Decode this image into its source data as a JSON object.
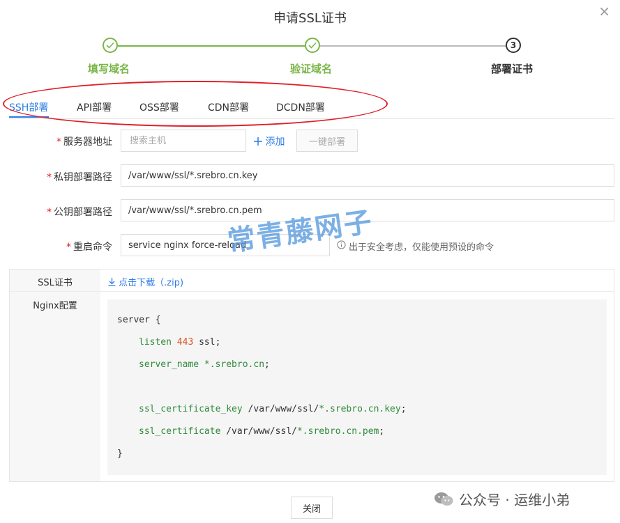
{
  "dialog": {
    "title": "申请SSL证书",
    "close_glyph": "×"
  },
  "steps": [
    {
      "label": "填写域名",
      "state": "done"
    },
    {
      "label": "验证域名",
      "state": "done"
    },
    {
      "label": "部署证书",
      "state": "current",
      "number": "3"
    }
  ],
  "colors": {
    "accent": "#2d7be5",
    "success": "#7ab648",
    "required": "#e0202a",
    "annotation": "#e0202a"
  },
  "tabs": [
    {
      "label": "SSH部署",
      "active": true
    },
    {
      "label": "API部署"
    },
    {
      "label": "OSS部署"
    },
    {
      "label": "CDN部署"
    },
    {
      "label": "DCDN部署"
    }
  ],
  "form": {
    "required_mark": "*",
    "server": {
      "label": "服务器地址",
      "placeholder": "搜索主机",
      "add_label": "添加",
      "deploy_label": "一键部署"
    },
    "key_path": {
      "label": "私钥部署路径",
      "value": "/var/www/ssl/*.srebro.cn.key"
    },
    "cert_path": {
      "label": "公钥部署路径",
      "value": "/var/www/ssl/*.srebro.cn.pem"
    },
    "restart": {
      "label": "重启命令",
      "value": "service nginx force-reload",
      "hint": "出于安全考虑，仅能使用预设的命令"
    }
  },
  "info": {
    "ssl_label": "SSL证书",
    "download_label": "点击下载（.zip)",
    "nginx_label": "Nginx配置"
  },
  "code": {
    "l1_a": "server",
    "l1_b": " {",
    "l2_kw": "listen",
    "l2_num": "443",
    "l2_rest": " ssl;",
    "l3_kw": "server_name",
    "l3_val": "*.srebro.cn",
    "l3_end": ";",
    "l4_kw": "ssl_certificate_key",
    "l4_path": "/var/www/ssl/",
    "l4_val": "*.srebro.cn.key",
    "l4_end": ";",
    "l5_kw": "ssl_certificate",
    "l5_path": "/var/www/ssl/",
    "l5_val": "*.srebro.cn.pem",
    "l5_end": ";",
    "l6": "}"
  },
  "footer": {
    "close_label": "关闭"
  },
  "watermark": {
    "text": "常青藤网子"
  },
  "wechat": {
    "text": "公众号 · 运维小弟",
    "icon": "wechat-icon"
  }
}
